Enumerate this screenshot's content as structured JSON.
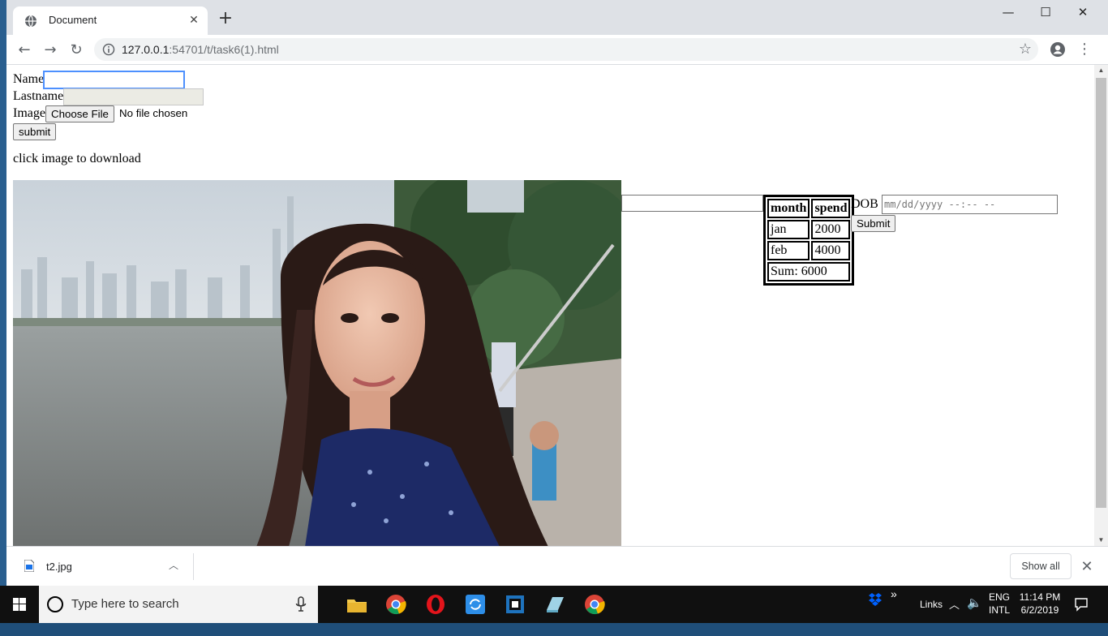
{
  "browser": {
    "tab_title": "Document",
    "url_host": "127.0.0.1",
    "url_rest": ":54701/t/task6(1).html"
  },
  "form": {
    "name_label": "Name",
    "name_value": "",
    "lastname_label": "Lastname",
    "lastname_value": "",
    "image_label": "Image",
    "choose_file_label": "Choose File",
    "file_status": "No file chosen",
    "submit_label": "submit"
  },
  "page": {
    "download_hint": "click image to download",
    "extra_input_value": "",
    "dob_label": "DOB",
    "dob_placeholder": "mm/dd/yyyy --:-- --",
    "dob_submit_label": "Submit"
  },
  "spend_table": {
    "headers": [
      "month",
      "spend"
    ],
    "rows": [
      {
        "month": "jan",
        "spend": "2000"
      },
      {
        "month": "feb",
        "spend": "4000"
      }
    ],
    "sum_text": "Sum: 6000"
  },
  "downloads": {
    "file_name": "t2.jpg",
    "show_all_label": "Show all"
  },
  "taskbar": {
    "search_placeholder": "Type here to search",
    "links_label": "Links",
    "lang_line1": "ENG",
    "lang_line2": "INTL",
    "time": "11:14 PM",
    "date": "6/2/2019",
    "overflow_label": "»"
  },
  "colors": {
    "accent": "#4d90fe",
    "chrome_frame": "#dee1e6",
    "taskbar": "#101010"
  }
}
